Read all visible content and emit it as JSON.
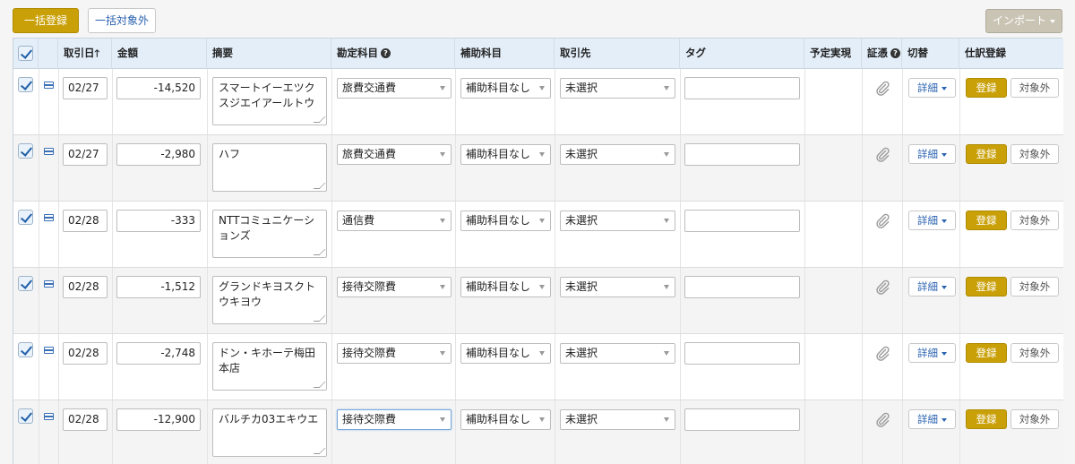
{
  "toolbar": {
    "bulk_register": "一括登録",
    "bulk_exclude": "一括対象外",
    "import": "インポート"
  },
  "columns": {
    "date": "取引日",
    "amount": "金額",
    "summary": "摘要",
    "account": "勘定科目",
    "sub_account": "補助科目",
    "partner": "取引先",
    "tag": "タグ",
    "planned": "予定実現",
    "evidence": "証憑",
    "switch": "切替",
    "journal": "仕訳登録"
  },
  "labels": {
    "detail": "詳細",
    "register": "登録",
    "exclude": "対象外",
    "help_glyph": "?",
    "sort_glyph": "🡑"
  },
  "rows": [
    {
      "date": "02/27",
      "amount": "-14,520",
      "summary": "スマートイーエツクスジエイアールトウ",
      "account": "旅費交通費",
      "sub_account": "補助科目なし",
      "partner": "未選択",
      "tag": "",
      "checked": true
    },
    {
      "date": "02/27",
      "amount": "-2,980",
      "summary": "ハフ",
      "account": "旅費交通費",
      "sub_account": "補助科目なし",
      "partner": "未選択",
      "tag": "",
      "checked": true
    },
    {
      "date": "02/28",
      "amount": "-333",
      "summary": "NTTコミュニケーションズ",
      "account": "通信費",
      "sub_account": "補助科目なし",
      "partner": "未選択",
      "tag": "",
      "checked": true
    },
    {
      "date": "02/28",
      "amount": "-1,512",
      "summary": "グランドキヨスクトウキヨウ",
      "account": "接待交際費",
      "sub_account": "補助科目なし",
      "partner": "未選択",
      "tag": "",
      "checked": true
    },
    {
      "date": "02/28",
      "amount": "-2,748",
      "summary": "ドン・キホーテ梅田本店",
      "account": "接待交際費",
      "sub_account": "補助科目なし",
      "partner": "未選択",
      "tag": "",
      "checked": true
    },
    {
      "date": "02/28",
      "amount": "-12,900",
      "summary": "バルチカ03エキウエ",
      "account": "接待交際費",
      "sub_account": "補助科目なし",
      "partner": "未選択",
      "tag": "",
      "checked": true
    }
  ],
  "colors": {
    "accent_gold": "#c9a008",
    "link_blue": "#2a62b0",
    "header_bg": "#e3eef9"
  }
}
